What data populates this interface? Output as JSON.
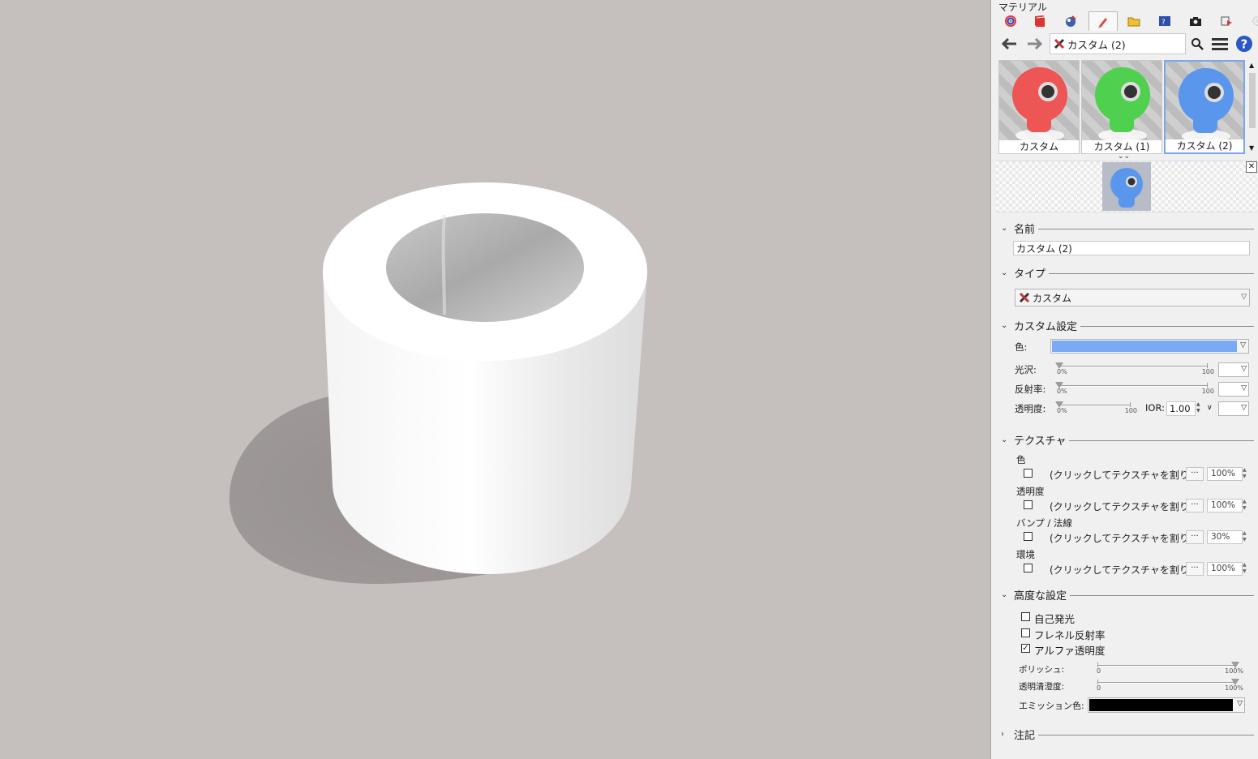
{
  "panel": {
    "title": "マテリアル",
    "tabs": [
      "color-wheel-icon",
      "book-icon",
      "paint-bucket-icon",
      "brush-icon",
      "folder-icon",
      "screen-icon",
      "camera-icon",
      "cube-arrow-icon",
      "gear-icon"
    ],
    "active_tab_index": 3,
    "nav": {
      "path_label": "カスタム (2)"
    },
    "materials": [
      {
        "label": "カスタム",
        "color": "#ee5555"
      },
      {
        "label": "カスタム (1)",
        "color": "#4fd04f"
      },
      {
        "label": "カスタム (2)",
        "color": "#5a97ec",
        "selected": true
      }
    ],
    "name_section": {
      "title": "名前",
      "value": "カスタム (2)"
    },
    "type_section": {
      "title": "タイプ",
      "value": "カスタム"
    },
    "custom_section": {
      "title": "カスタム設定",
      "color_label": "色:",
      "color_value": "#7aaaf5",
      "gloss": {
        "label": "光沢:",
        "min": "0%",
        "max": "100",
        "value": 0
      },
      "reflectivity": {
        "label": "反射率:",
        "min": "0%",
        "max": "100",
        "value": 0
      },
      "transparency": {
        "label": "透明度:",
        "min": "0%",
        "max": "100",
        "value": 0
      },
      "ior_label": "IOR:",
      "ior_value": "1.00"
    },
    "texture_section": {
      "title": "テクスチャ",
      "rows": [
        {
          "label": "色",
          "text": "(クリックしてテクスチャを割り...",
          "dots": "···",
          "percent": "100%"
        },
        {
          "label": "透明度",
          "text": "(クリックしてテクスチャを割り...",
          "dots": "···",
          "percent": "100%"
        },
        {
          "label": "バンプ / 法線",
          "text": "(クリックしてテクスチャを割り...",
          "dots": "···",
          "percent": "30%"
        },
        {
          "label": "環境",
          "text": "(クリックしてテクスチャを割り...",
          "dots": "···",
          "percent": "100%"
        }
      ]
    },
    "advanced_section": {
      "title": "高度な設定",
      "self_illum": {
        "label": "自己発光",
        "checked": false
      },
      "fresnel": {
        "label": "フレネル反射率",
        "checked": false
      },
      "alpha": {
        "label": "アルファ透明度",
        "checked": true
      },
      "polish": {
        "label": "ポリッシュ:",
        "min": "0",
        "max": "100%",
        "value": 1.0
      },
      "clarity": {
        "label": "透明清澄度:",
        "min": "0",
        "max": "100%",
        "value": 1.0
      },
      "emission_label": "エミッション色:",
      "emission_color": "#000000"
    },
    "notes_section": {
      "title": "注記"
    }
  }
}
